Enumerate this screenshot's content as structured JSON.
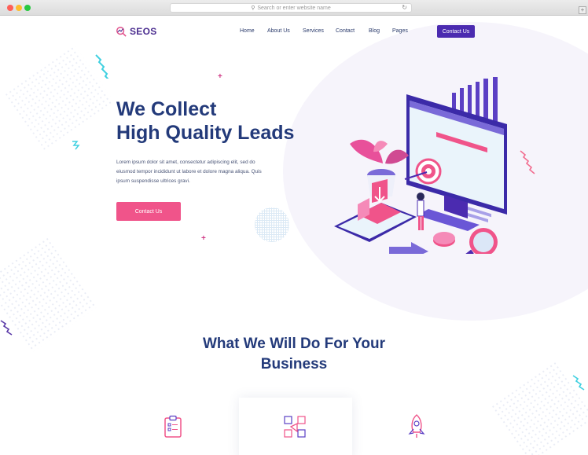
{
  "browser": {
    "url_placeholder": "Search or enter website name"
  },
  "brand": {
    "name": "SEOS",
    "colors": {
      "primary": "#4b2bb0",
      "accent": "#f0548a",
      "heading": "#233a7a"
    }
  },
  "nav": {
    "items": [
      {
        "label": "Home"
      },
      {
        "label": "About Us"
      },
      {
        "label": "Services"
      },
      {
        "label": "Contact"
      },
      {
        "label": "Blog"
      },
      {
        "label": "Pages"
      }
    ],
    "cta_label": "Contact Us"
  },
  "hero": {
    "title_line1": "We Collect",
    "title_line2": "High Quality Leads",
    "body": "Lorem ipsum dolor sit amet, consectetur adipiscing elit, sed do eiusmod tempor incididunt ut labore et dolore magna aliqua. Quis ipsum suspendisse ultrices gravi.",
    "button_label": "Contact Us"
  },
  "features": {
    "title_line1": "What We Will Do For Your",
    "title_line2": "Business",
    "items": [
      {
        "icon": "clipboard-icon"
      },
      {
        "icon": "marketing-icon"
      },
      {
        "icon": "rocket-icon"
      }
    ]
  }
}
